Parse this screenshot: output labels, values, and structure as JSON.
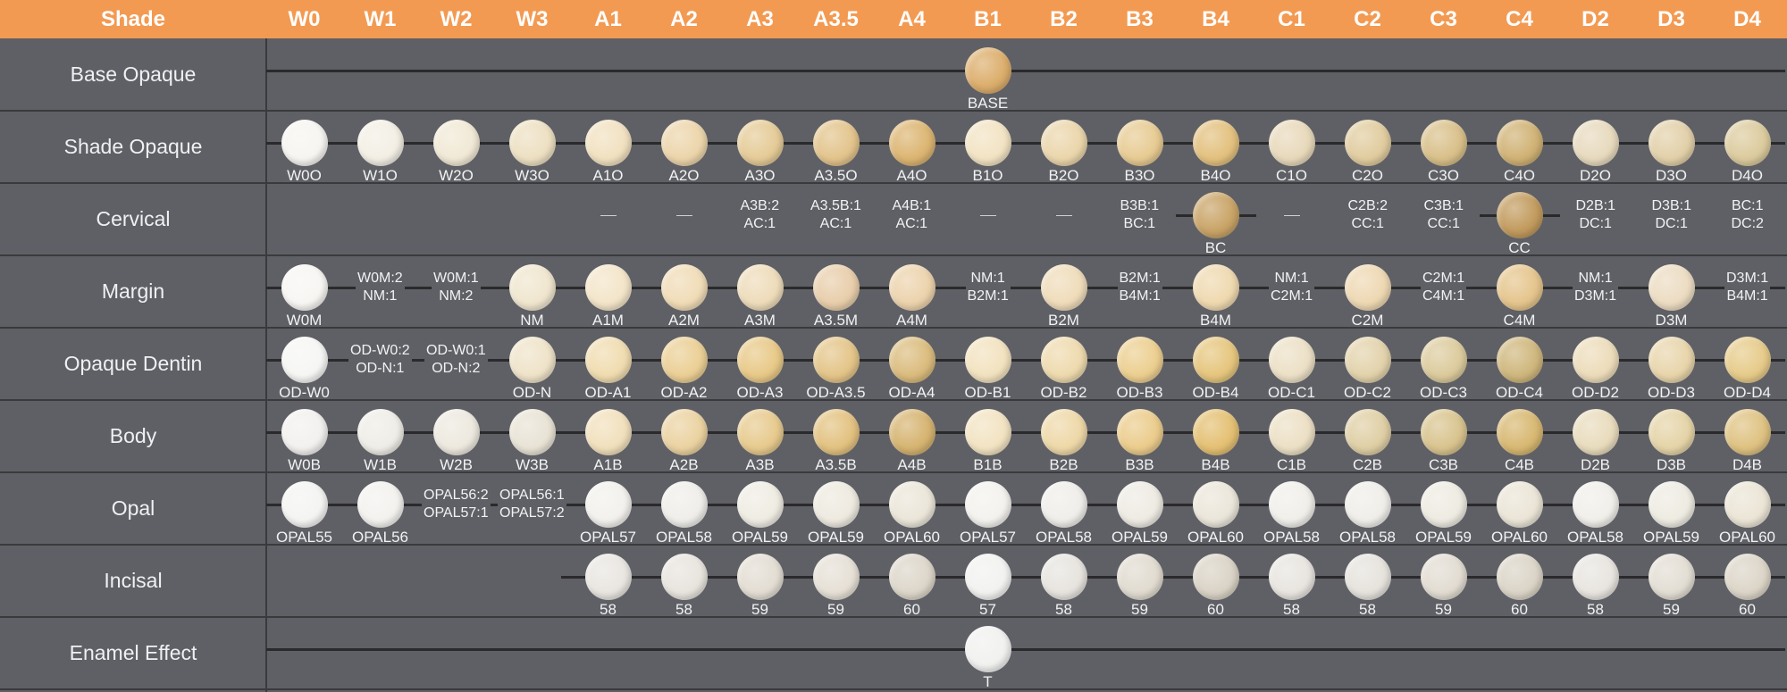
{
  "header": {
    "shade_label": "Shade",
    "shades": [
      "W0",
      "W1",
      "W2",
      "W3",
      "A1",
      "A2",
      "A3",
      "A3.5",
      "A4",
      "B1",
      "B2",
      "B3",
      "B4",
      "C1",
      "C2",
      "C3",
      "C4",
      "D2",
      "D3",
      "D4"
    ]
  },
  "colors": {
    "header_bg": "#f39a52",
    "panel_bg": "#5f6065",
    "line": "#2a2a2c"
  },
  "rows": [
    {
      "label": "Base Opaque",
      "line": "full",
      "cells": [
        null,
        null,
        null,
        null,
        null,
        null,
        null,
        null,
        null,
        {
          "disc": "BASE",
          "label": "BASE",
          "color": "#dcae6c"
        },
        null,
        null,
        null,
        null,
        null,
        null,
        null,
        null,
        null,
        null
      ]
    },
    {
      "label": "Shade Opaque",
      "line": "full",
      "cells": [
        {
          "disc": "W0O",
          "label": "W0O",
          "color": "#f6f5f1"
        },
        {
          "disc": "W1O",
          "label": "W1O",
          "color": "#f3efe5"
        },
        {
          "disc": "W2O",
          "label": "W2O",
          "color": "#f1e9d6"
        },
        {
          "disc": "W3O",
          "label": "W3O",
          "color": "#ede0c2"
        },
        {
          "disc": "A1O",
          "label": "A1O",
          "color": "#f1e1c0"
        },
        {
          "disc": "A2O",
          "label": "A2O",
          "color": "#ecd5ab"
        },
        {
          "disc": "A3O",
          "label": "A3O",
          "color": "#e5cb97"
        },
        {
          "disc": "A3.5O",
          "label": "A3.5O",
          "color": "#e3c48c"
        },
        {
          "disc": "A4O",
          "label": "A4O",
          "color": "#dcb572"
        },
        {
          "disc": "B1O",
          "label": "B1O",
          "color": "#f2e3c3"
        },
        {
          "disc": "B2O",
          "label": "B2O",
          "color": "#ebd6ac"
        },
        {
          "disc": "B3O",
          "label": "B3O",
          "color": "#e7cb93"
        },
        {
          "disc": "B4O",
          "label": "B4O",
          "color": "#e3c17f"
        },
        {
          "disc": "C1O",
          "label": "C1O",
          "color": "#e8d9bb"
        },
        {
          "disc": "C2O",
          "label": "C2O",
          "color": "#e1cc9f"
        },
        {
          "disc": "C3O",
          "label": "C3O",
          "color": "#d9c08a"
        },
        {
          "disc": "C4O",
          "label": "C4O",
          "color": "#d0b275"
        },
        {
          "disc": "D2O",
          "label": "D2O",
          "color": "#e7dabe"
        },
        {
          "disc": "D3O",
          "label": "D3O",
          "color": "#e2d0a9"
        },
        {
          "disc": "D4O",
          "label": "D4O",
          "color": "#dccb9e"
        }
      ]
    },
    {
      "label": "Cervical",
      "line": "none",
      "cells": [
        null,
        null,
        null,
        null,
        {
          "dash": true
        },
        {
          "dash": true
        },
        {
          "mix": [
            "A3B:2",
            "AC:1"
          ]
        },
        {
          "mix": [
            "A3.5B:1",
            "AC:1"
          ]
        },
        {
          "mix": [
            "A4B:1",
            "AC:1"
          ]
        },
        {
          "dash": true
        },
        {
          "dash": true
        },
        {
          "mix": [
            "B3B:1",
            "BC:1"
          ]
        },
        {
          "disc": "BC",
          "label": "BC",
          "color": "#c9a467",
          "short_line": true
        },
        {
          "dash": true
        },
        {
          "mix": [
            "C2B:2",
            "CC:1"
          ]
        },
        {
          "mix": [
            "C3B:1",
            "CC:1"
          ]
        },
        {
          "disc": "CC",
          "label": "CC",
          "color": "#c29b5e",
          "short_line": true
        },
        {
          "mix": [
            "D2B:1",
            "DC:1"
          ]
        },
        {
          "mix": [
            "D3B:1",
            "DC:1"
          ]
        },
        {
          "mix": [
            "BC:1",
            "DC:2"
          ]
        }
      ]
    },
    {
      "label": "Margin",
      "line": "partial",
      "cells": [
        {
          "disc": "W0M",
          "label": "W0M",
          "color": "#f7f6f3"
        },
        {
          "mix": [
            "W0M:2",
            "NM:1"
          ]
        },
        {
          "mix": [
            "W0M:1",
            "NM:2"
          ]
        },
        {
          "disc": "NM",
          "label": "NM",
          "color": "#f0e6cf"
        },
        {
          "disc": "A1M",
          "label": "A1M",
          "color": "#f3e5c9"
        },
        {
          "disc": "A2M",
          "label": "A2M",
          "color": "#f0dcb7"
        },
        {
          "disc": "A3M",
          "label": "A3M",
          "color": "#eedcba"
        },
        {
          "disc": "A3.5M",
          "label": "A3.5M",
          "color": "#e8ceab"
        },
        {
          "disc": "A4M",
          "label": "A4M",
          "color": "#ecd3ad"
        },
        {
          "mix": [
            "NM:1",
            "B2M:1"
          ]
        },
        {
          "disc": "B2M",
          "label": "B2M",
          "color": "#efdcba"
        },
        {
          "mix": [
            "B2M:1",
            "B4M:1"
          ]
        },
        {
          "disc": "B4M",
          "label": "B4M",
          "color": "#efd9b0"
        },
        {
          "mix": [
            "NM:1",
            "C2M:1"
          ]
        },
        {
          "disc": "C2M",
          "label": "C2M",
          "color": "#eed8b3"
        },
        {
          "mix": [
            "C2M:1",
            "C4M:1"
          ]
        },
        {
          "disc": "C4M",
          "label": "C4M",
          "color": "#e5c58d"
        },
        {
          "mix": [
            "NM:1",
            "D3M:1"
          ]
        },
        {
          "disc": "D3M",
          "label": "D3M",
          "color": "#ecdcc2"
        },
        {
          "mix": [
            "D3M:1",
            "B4M:1"
          ]
        }
      ]
    },
    {
      "label": "Opaque Dentin",
      "line": "full",
      "cells": [
        {
          "disc": "OD-W0",
          "label": "OD-W0",
          "color": "#f6f6f4"
        },
        {
          "mix": [
            "OD-W0:2",
            "OD-N:1"
          ]
        },
        {
          "mix": [
            "OD-W0:1",
            "OD-N:2"
          ]
        },
        {
          "disc": "OD-N",
          "label": "OD-N",
          "color": "#efe3c9"
        },
        {
          "disc": "OD-A1",
          "label": "OD-A1",
          "color": "#f0dcb0"
        },
        {
          "disc": "OD-A2",
          "label": "OD-A2",
          "color": "#ebcf95"
        },
        {
          "disc": "OD-A3",
          "label": "OD-A3",
          "color": "#e8c988"
        },
        {
          "disc": "OD-A3.5",
          "label": "OD-A3.5",
          "color": "#e4c589"
        },
        {
          "disc": "OD-A4",
          "label": "OD-A4",
          "color": "#dbbc7e"
        },
        {
          "disc": "OD-B1",
          "label": "OD-B1",
          "color": "#f2e2bf"
        },
        {
          "disc": "OD-B2",
          "label": "OD-B2",
          "color": "#eedaae"
        },
        {
          "disc": "OD-B3",
          "label": "OD-B3",
          "color": "#eccf90"
        },
        {
          "disc": "OD-B4",
          "label": "OD-B4",
          "color": "#e6c67e"
        },
        {
          "disc": "OD-C1",
          "label": "OD-C1",
          "color": "#ece0c6"
        },
        {
          "disc": "OD-C2",
          "label": "OD-C2",
          "color": "#e3d3ac"
        },
        {
          "disc": "OD-C3",
          "label": "OD-C3",
          "color": "#dccb9d"
        },
        {
          "disc": "OD-C4",
          "label": "OD-C4",
          "color": "#cfb77d"
        },
        {
          "disc": "OD-D2",
          "label": "OD-D2",
          "color": "#ecdcba"
        },
        {
          "disc": "OD-D3",
          "label": "OD-D3",
          "color": "#e8d5ab"
        },
        {
          "disc": "OD-D4",
          "label": "OD-D4",
          "color": "#e6cb8a"
        }
      ]
    },
    {
      "label": "Body",
      "line": "full",
      "cells": [
        {
          "disc": "W0B",
          "label": "W0B",
          "color": "#f2f1ef"
        },
        {
          "disc": "W1B",
          "label": "W1B",
          "color": "#efede7"
        },
        {
          "disc": "W2B",
          "label": "W2B",
          "color": "#ede9df"
        },
        {
          "disc": "W3B",
          "label": "W3B",
          "color": "#e8e3d5"
        },
        {
          "disc": "A1B",
          "label": "A1B",
          "color": "#f1e0bc"
        },
        {
          "disc": "A2B",
          "label": "A2B",
          "color": "#ebd2a1"
        },
        {
          "disc": "A3B",
          "label": "A3B",
          "color": "#e7ca8e"
        },
        {
          "disc": "A3.5B",
          "label": "A3.5B",
          "color": "#e3c281"
        },
        {
          "disc": "A4B",
          "label": "A4B",
          "color": "#d6b471"
        },
        {
          "disc": "B1B",
          "label": "B1B",
          "color": "#f2e3c2"
        },
        {
          "disc": "B2B",
          "label": "B2B",
          "color": "#eed8a8"
        },
        {
          "disc": "B3B",
          "label": "B3B",
          "color": "#ebcc8c"
        },
        {
          "disc": "B4B",
          "label": "B4B",
          "color": "#e4c073"
        },
        {
          "disc": "C1B",
          "label": "C1B",
          "color": "#ece0c5"
        },
        {
          "disc": "C2B",
          "label": "C2B",
          "color": "#dfcfa5"
        },
        {
          "disc": "C3B",
          "label": "C3B",
          "color": "#d9c48f"
        },
        {
          "disc": "C4B",
          "label": "C4B",
          "color": "#d8b872"
        },
        {
          "disc": "D2B",
          "label": "D2B",
          "color": "#e9dcbd"
        },
        {
          "disc": "D3B",
          "label": "D3B",
          "color": "#e5d4a8"
        },
        {
          "disc": "D4B",
          "label": "D4B",
          "color": "#dfc282"
        }
      ]
    },
    {
      "label": "Opal",
      "line": "partial",
      "cells": [
        {
          "disc": "OPAL55",
          "label": "OPAL55",
          "color": "#f4f4f3"
        },
        {
          "disc": "OPAL56",
          "label": "OPAL56",
          "color": "#f3f2ef"
        },
        {
          "mix": [
            "OPAL56:2",
            "OPAL57:1"
          ]
        },
        {
          "mix": [
            "OPAL56:1",
            "OPAL57:2"
          ]
        },
        {
          "disc": "OPAL57",
          "label": "OPAL57",
          "color": "#f2f1ed"
        },
        {
          "disc": "OPAL58",
          "label": "OPAL58",
          "color": "#efeeea"
        },
        {
          "disc": "OPAL59",
          "label": "OPAL59",
          "color": "#efece3"
        },
        {
          "disc": "OPAL59",
          "label": "OPAL59",
          "color": "#eeeae0"
        },
        {
          "disc": "OPAL60",
          "label": "OPAL60",
          "color": "#ebe6d9"
        },
        {
          "disc": "OPAL57",
          "label": "OPAL57",
          "color": "#f3f2ee"
        },
        {
          "disc": "OPAL58",
          "label": "OPAL58",
          "color": "#f0eeea"
        },
        {
          "disc": "OPAL59",
          "label": "OPAL59",
          "color": "#eeebe3"
        },
        {
          "disc": "OPAL60",
          "label": "OPAL60",
          "color": "#ebe6da"
        },
        {
          "disc": "OPAL58",
          "label": "OPAL58",
          "color": "#f0efea"
        },
        {
          "disc": "OPAL58",
          "label": "OPAL58",
          "color": "#f0eee9"
        },
        {
          "disc": "OPAL59",
          "label": "OPAL59",
          "color": "#eeebe2"
        },
        {
          "disc": "OPAL60",
          "label": "OPAL60",
          "color": "#ebe5d7"
        },
        {
          "disc": "OPAL58",
          "label": "OPAL58",
          "color": "#f1efea"
        },
        {
          "disc": "OPAL59",
          "label": "OPAL59",
          "color": "#eeebe2"
        },
        {
          "disc": "OPAL60",
          "label": "OPAL60",
          "color": "#ebe5d6"
        }
      ]
    },
    {
      "label": "Incisal",
      "line": "from4",
      "cells": [
        null,
        null,
        null,
        null,
        {
          "disc": "58",
          "label": "58",
          "color": "#e9e6e1"
        },
        {
          "disc": "58",
          "label": "58",
          "color": "#e8e4de"
        },
        {
          "disc": "59",
          "label": "59",
          "color": "#e3ddd3"
        },
        {
          "disc": "59",
          "label": "59",
          "color": "#e6e0d6"
        },
        {
          "disc": "60",
          "label": "60",
          "color": "#ddd6ca"
        },
        {
          "disc": "57",
          "label": "57",
          "color": "#f2f2f1"
        },
        {
          "disc": "58",
          "label": "58",
          "color": "#e7e4df"
        },
        {
          "disc": "59",
          "label": "59",
          "color": "#e1dbd0"
        },
        {
          "disc": "60",
          "label": "60",
          "color": "#dad3c6"
        },
        {
          "disc": "58",
          "label": "58",
          "color": "#e8e5e0"
        },
        {
          "disc": "58",
          "label": "58",
          "color": "#e6e3dd"
        },
        {
          "disc": "59",
          "label": "59",
          "color": "#e2dcd2"
        },
        {
          "disc": "60",
          "label": "60",
          "color": "#dbd4c7"
        },
        {
          "disc": "58",
          "label": "58",
          "color": "#e8e5e0"
        },
        {
          "disc": "59",
          "label": "59",
          "color": "#e3ded4"
        },
        {
          "disc": "60",
          "label": "60",
          "color": "#dcd5c8"
        }
      ]
    },
    {
      "label": "Enamel Effect",
      "line": "full",
      "cells": [
        null,
        null,
        null,
        null,
        null,
        null,
        null,
        null,
        null,
        {
          "disc": "T",
          "label": "T",
          "color": "#f1f1f0"
        },
        null,
        null,
        null,
        null,
        null,
        null,
        null,
        null,
        null,
        null
      ]
    }
  ]
}
